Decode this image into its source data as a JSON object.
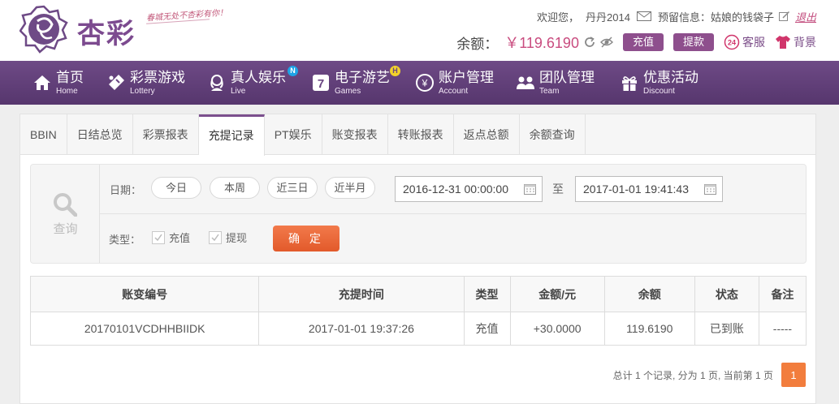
{
  "brand": {
    "name": "杏彩",
    "slogan": "春城无处不杏彩有你！"
  },
  "user": {
    "welcome": "欢迎您，",
    "username": "丹丹2014",
    "warning_label": "预留信息：",
    "warning_value": "姑娘的钱袋子",
    "logout": "退出"
  },
  "balance": {
    "label": "余额：",
    "value": "￥119.6190",
    "deposit": "充值",
    "withdraw": "提款",
    "service": "客服",
    "background": "背景"
  },
  "nav": [
    {
      "cn": "首页",
      "en": "Home"
    },
    {
      "cn": "彩票游戏",
      "en": "Lottery"
    },
    {
      "cn": "真人娱乐",
      "en": "Live",
      "badge": "N"
    },
    {
      "cn": "电子游艺",
      "en": "Games",
      "badge": "H"
    },
    {
      "cn": "账户管理",
      "en": "Account"
    },
    {
      "cn": "团队管理",
      "en": "Team"
    },
    {
      "cn": "优惠活动",
      "en": "Discount"
    }
  ],
  "tabs": [
    "BBIN",
    "日结总览",
    "彩票报表",
    "充提记录",
    "PT娱乐",
    "账变报表",
    "转账报表",
    "返点总额",
    "余额查询"
  ],
  "active_tab": "充提记录",
  "filter": {
    "query_label": "查询",
    "date_label": "日期：",
    "quick_dates": [
      "今日",
      "本周",
      "近三日",
      "近半月"
    ],
    "start_date": "2016-12-31 00:00:00",
    "to_label": "至",
    "end_date": "2017-01-01 19:41:43",
    "type_label": "类型：",
    "types": [
      "充值",
      "提现"
    ],
    "confirm": "确 定"
  },
  "table": {
    "headers": [
      "账变编号",
      "充提时间",
      "类型",
      "金额/元",
      "余额",
      "状态",
      "备注"
    ],
    "rows": [
      [
        "20170101VCDHHBIIDK",
        "2017-01-01 19:37:26",
        "充值",
        "+30.0000",
        "119.6190",
        "已到账",
        "-----"
      ]
    ]
  },
  "pagination": {
    "summary": "总计 1 个记录, 分为 1 页, 当前第 1 页",
    "current": "1"
  }
}
